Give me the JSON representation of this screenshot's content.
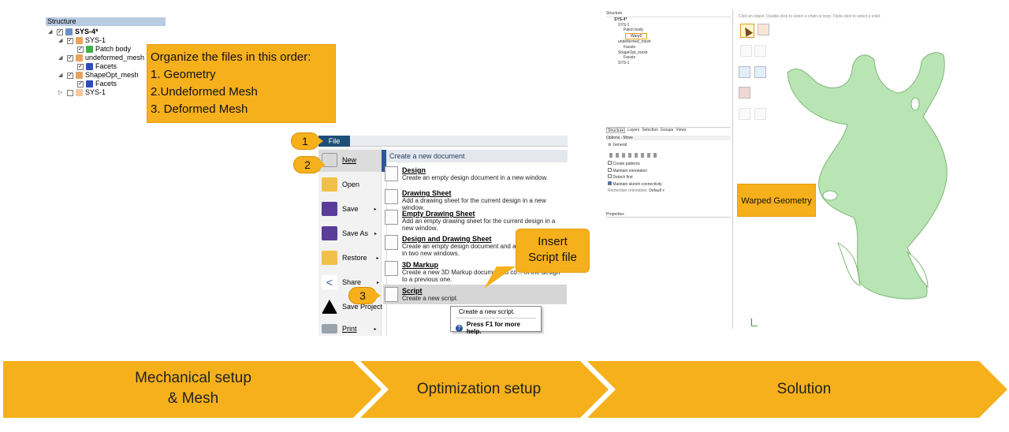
{
  "structure_panel": {
    "header": "Structure",
    "tree": [
      {
        "label": "SYS-4*",
        "bold": true
      },
      {
        "label": "SYS-1"
      },
      {
        "label": "Patch body"
      },
      {
        "label": "undeformed_mesh"
      },
      {
        "label": "Facets"
      },
      {
        "label": "ShapeOpt_mesh"
      },
      {
        "label": "Facets"
      },
      {
        "label": "SYS-1"
      }
    ]
  },
  "organize_callout": {
    "lines": [
      "Organize the files in this order:",
      "1. Geometry",
      "2.Undeformed Mesh",
      "3. Deformed Mesh"
    ]
  },
  "file_menu": {
    "file_tab": "File",
    "steps": [
      "1",
      "2",
      "3"
    ],
    "items": [
      {
        "label": "New",
        "icon": "new-document-icon"
      },
      {
        "label": "Open",
        "icon": "open-folder-icon"
      },
      {
        "label": "Save",
        "icon": "save-disk-icon"
      },
      {
        "label": "Save As",
        "icon": "save-as-icon"
      },
      {
        "label": "Restore",
        "icon": "restore-folder-icon"
      },
      {
        "label": "Share",
        "icon": "share-icon"
      },
      {
        "label": "Save Project",
        "icon": "ansys-logo-icon"
      },
      {
        "label": "Print",
        "icon": "print-icon"
      }
    ],
    "submenu_header": "Create a new document",
    "submenu": [
      {
        "title": "Design",
        "desc": "Create an empty design document in a new window."
      },
      {
        "title": "Drawing Sheet",
        "desc": "Add a drawing sheet for the current design in a new window."
      },
      {
        "title": "Empty Drawing Sheet",
        "desc": "Add an empty drawing sheet for the current design in a new window."
      },
      {
        "title": "Design and Drawing Sheet",
        "desc": "Create an empty design document and a dr... that design in two new windows."
      },
      {
        "title": "3D Markup",
        "desc": "Create a new 3D Markup document to co... of the design to a previous one."
      },
      {
        "title": "Script",
        "desc": "Create a new script."
      }
    ],
    "tooltip": {
      "line1": "Create a new script.",
      "line2": "Press F1 for more help."
    },
    "insert_callout": "Insert Script file"
  },
  "right_app": {
    "structure_header": "Structure",
    "tree": [
      "SYS-4*",
      "SYS-1",
      "Patch body",
      "Warp0",
      "undeformed_mesh",
      "Facets",
      "ShapeOpt_mesh",
      "Facets",
      "SYS-1"
    ],
    "hint": "Click an object.  Double-click to select a chain or loop.  Triple-click to select a solid.",
    "tabs": [
      "Structure",
      "Layers",
      "Selection",
      "Groups",
      "Views"
    ],
    "options_header": "Options - Move",
    "general": "General",
    "checkboxes": [
      {
        "label": "Create patterns",
        "checked": false
      },
      {
        "label": "Maintain orientation",
        "checked": false
      },
      {
        "label": "Detach first",
        "checked": false
      },
      {
        "label": "Maintain sketch connectivity",
        "checked": true
      }
    ],
    "remember_orientation": "Remember orientation:",
    "orientation_value": "Default",
    "properties_header": "Properties",
    "warped_label": "Warped Geometry"
  },
  "process_steps": [
    {
      "line1": "Mechanical setup",
      "line2": "& Mesh"
    },
    {
      "line1": "Optimization setup",
      "line2": ""
    },
    {
      "line1": "Solution",
      "line2": ""
    }
  ],
  "colors": {
    "accent": "#f6b01c",
    "file_blue": "#1f4e79",
    "geometry_green": "#b9e4b3"
  }
}
